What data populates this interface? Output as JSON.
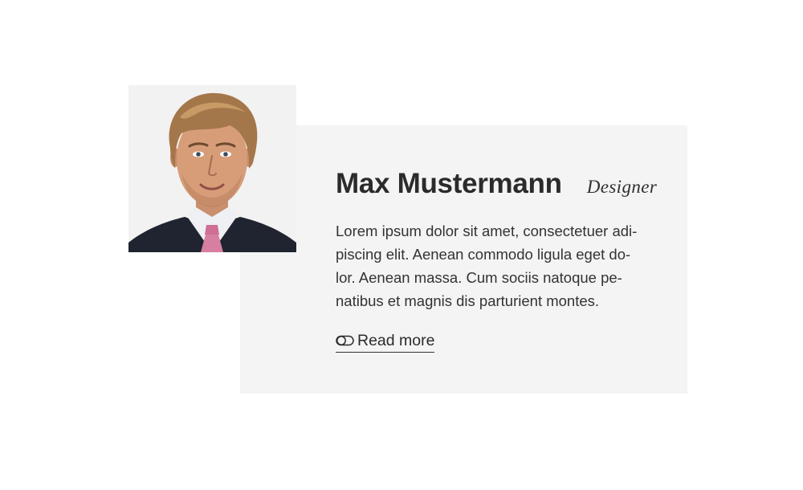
{
  "profile": {
    "name": "Max Mustermann",
    "role": "Designer",
    "bio_lines": [
      "Lorem ipsum dolor sit amet, consectetuer adi-",
      "piscing elit. Aenean commodo ligula eget do-",
      "lor. Aenean massa. Cum sociis natoque pe-",
      "natibus et magnis dis parturient montes."
    ],
    "read_more_label": "Read more",
    "read_more_icon": "toggle-pill-icon"
  },
  "colors": {
    "page_background": "#ffffff",
    "card_background": "#f4f4f4",
    "photo_background": "#f2f2f2",
    "text": "#2b2b2b"
  }
}
